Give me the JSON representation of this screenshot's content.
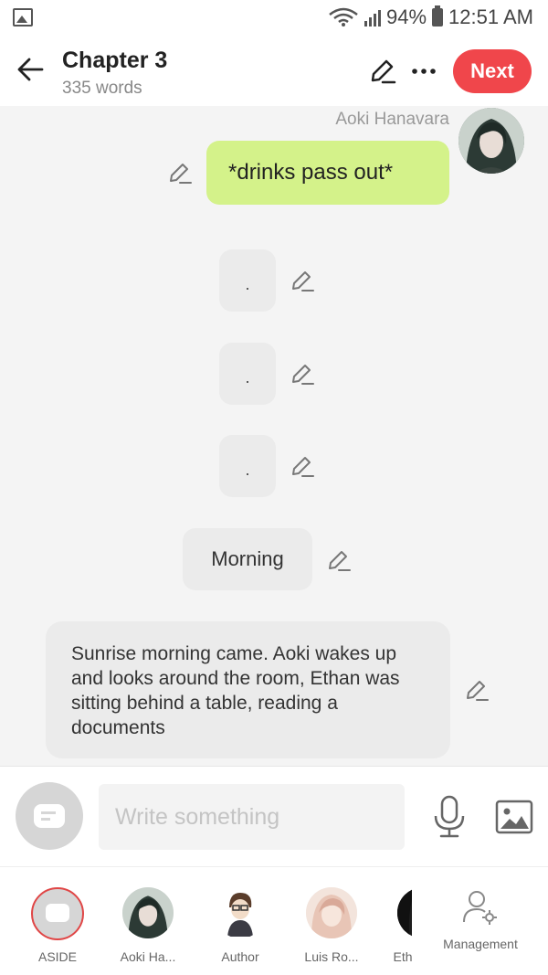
{
  "status_bar": {
    "battery": "94%",
    "time": "12:51 AM",
    "left_icon": "gallery-icon",
    "icons": [
      "wifi-icon",
      "signal-icon",
      "battery-icon"
    ]
  },
  "header": {
    "title": "Chapter 3",
    "word_count": "335 words",
    "next_label": "Next",
    "icons": [
      "back-arrow-icon",
      "pencil-icon",
      "more-icon"
    ],
    "accent_color": "#f0464b"
  },
  "chat": {
    "sender_name": "Aoki Hanavara",
    "messages": [
      {
        "type": "character",
        "text": "*drinks pass out*",
        "color": "#d4f28a"
      },
      {
        "type": "narration",
        "text": "."
      },
      {
        "type": "narration",
        "text": "."
      },
      {
        "type": "narration",
        "text": "."
      },
      {
        "type": "narration",
        "text": "Morning"
      },
      {
        "type": "narration",
        "text": "Sunrise morning came. Aoki wakes up and looks around the room, Ethan was sitting behind a table, reading a documents"
      }
    ]
  },
  "composer": {
    "placeholder": "Write something",
    "icons": [
      "aside-icon",
      "microphone-icon",
      "image-icon"
    ]
  },
  "characters": [
    {
      "label": "ASIDE"
    },
    {
      "label": "Aoki Ha..."
    },
    {
      "label": "Author"
    },
    {
      "label": "Luis Ro..."
    },
    {
      "label": "Eth"
    }
  ],
  "management": {
    "label": "Management",
    "icon": "user-gear-icon"
  }
}
